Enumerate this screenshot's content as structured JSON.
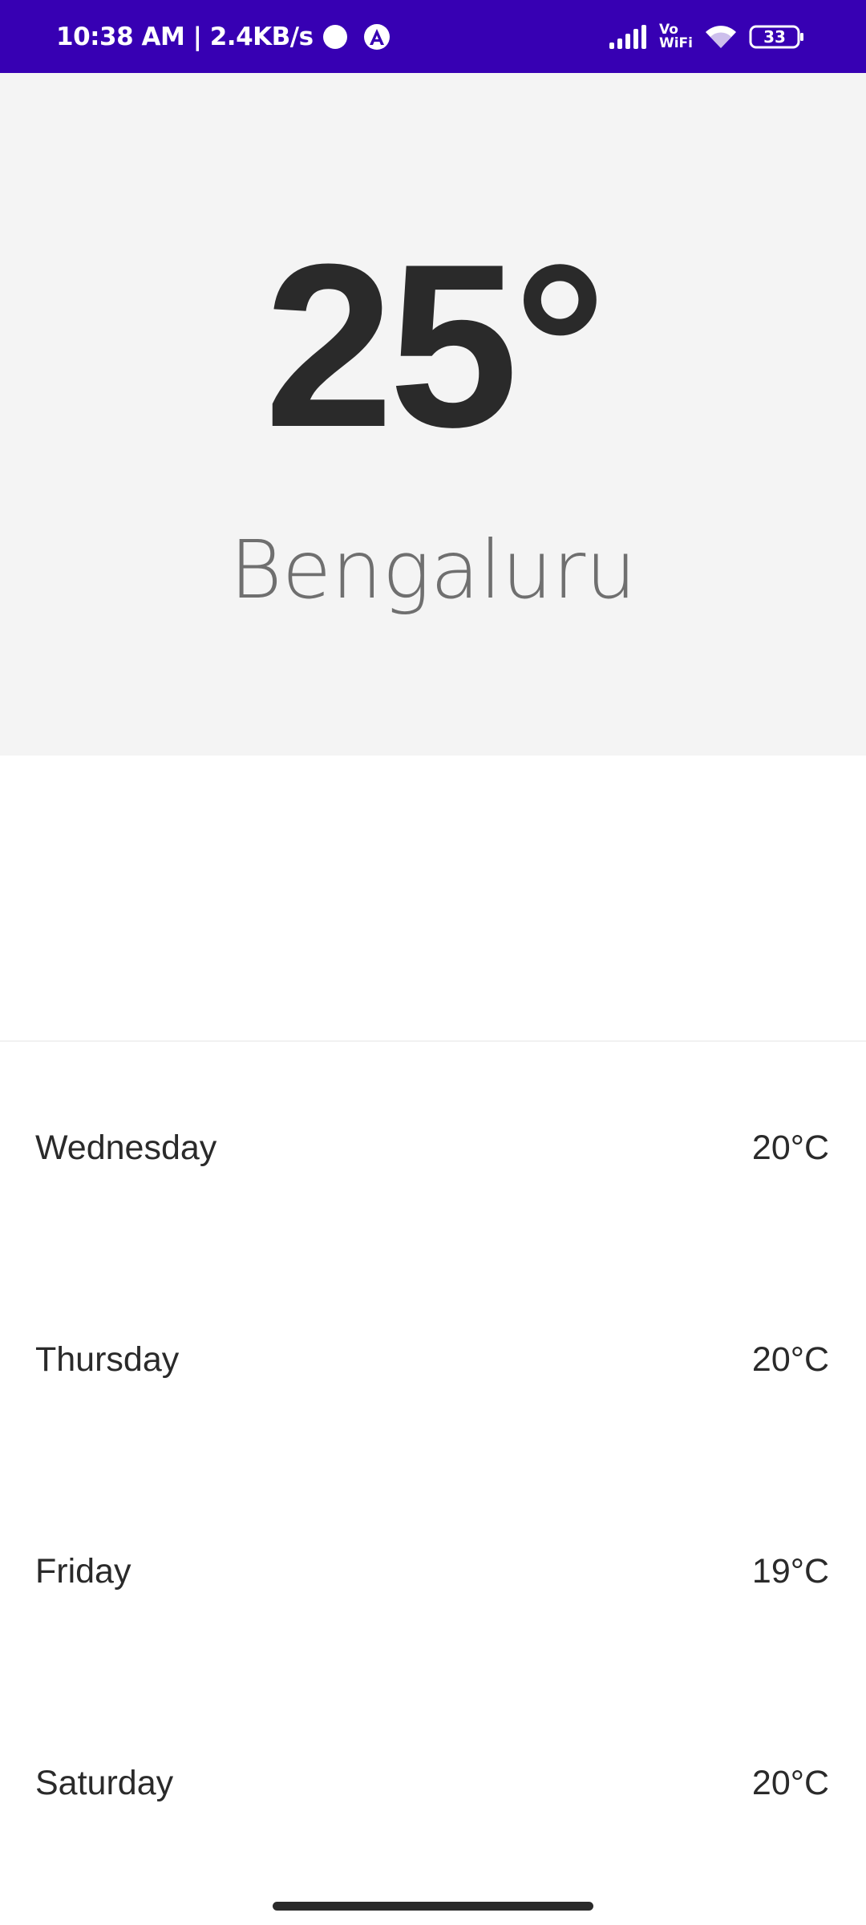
{
  "status_bar": {
    "time_speed": "10:38 AM | 2.4KB/s",
    "vowifi_top": "Vo",
    "vowifi_bottom": "WiFi",
    "battery": "33",
    "icons": [
      "circle-notification-icon",
      "a-notification-icon",
      "signal-icon",
      "vowifi-icon",
      "wifi-icon",
      "battery-icon"
    ]
  },
  "weather": {
    "current_temp": "25°",
    "city": "Bengaluru"
  },
  "forecast": [
    {
      "day": "Wednesday",
      "temp": "20°C"
    },
    {
      "day": "Thursday",
      "temp": "20°C"
    },
    {
      "day": "Friday",
      "temp": "19°C"
    },
    {
      "day": "Saturday",
      "temp": "20°C"
    }
  ],
  "colors": {
    "status_bar": "#3700b3",
    "hero_background": "#f4f4f4",
    "primary_text": "#2a2a2a",
    "city_text": "#6f6f6f"
  }
}
